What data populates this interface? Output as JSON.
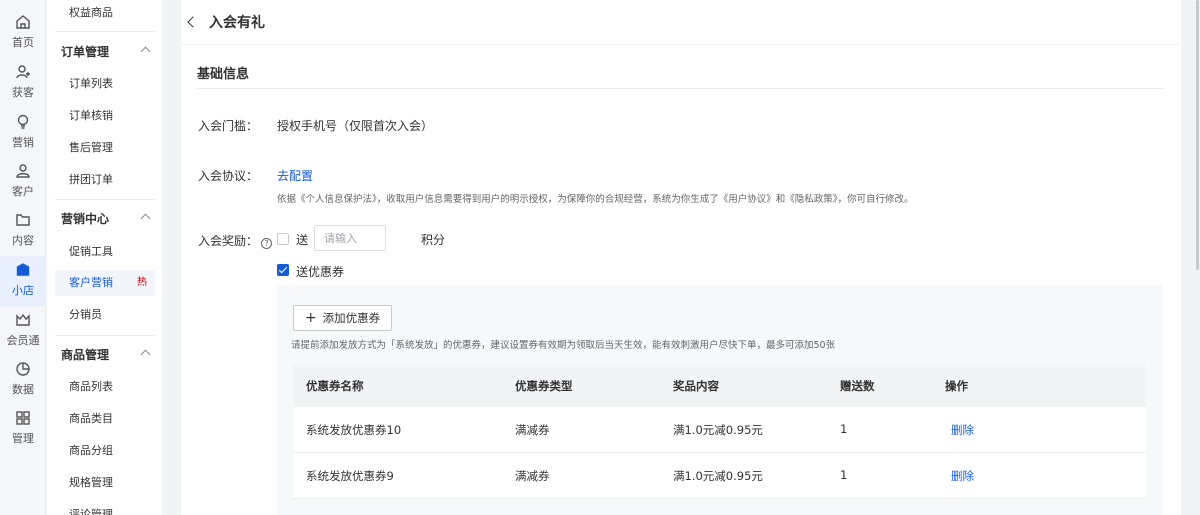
{
  "rail": [
    {
      "label": "首页",
      "icon": "home-icon"
    },
    {
      "label": "获客",
      "icon": "user-add-icon"
    },
    {
      "label": "营销",
      "icon": "bulb-icon"
    },
    {
      "label": "客户",
      "icon": "user-icon"
    },
    {
      "label": "内容",
      "icon": "folder-icon"
    },
    {
      "label": "小店",
      "icon": "store-icon",
      "active": true
    },
    {
      "label": "会员通",
      "icon": "crown-icon"
    },
    {
      "label": "数据",
      "icon": "pie-chart-icon"
    },
    {
      "label": "管理",
      "icon": "grid-icon"
    }
  ],
  "submenu": {
    "top_item": "权益商品",
    "groups": [
      {
        "title": "订单管理",
        "items": [
          "订单列表",
          "订单核销",
          "售后管理",
          "拼团订单"
        ]
      },
      {
        "title": "营销中心",
        "items": [
          "促销工具",
          "客户营销",
          "分销员"
        ]
      },
      {
        "title": "商品管理",
        "items": [
          "商品列表",
          "商品类目",
          "商品分组",
          "规格管理",
          "评论管理"
        ]
      }
    ],
    "active_item": "客户营销",
    "hot_badge": "热"
  },
  "header": {
    "title": "入会有礼"
  },
  "section": {
    "title": "基础信息"
  },
  "form": {
    "threshold": {
      "label": "入会门槛：",
      "value": "授权手机号（仅限首次入会）"
    },
    "agreement": {
      "label": "入会协议：",
      "link": "去配置",
      "help": "依据《个人信息保护法》，收取用户信息需要得到用户的明示授权，为保障你的合规经营，系统为你生成了《用户协议》和《隐私政策》，你可自行修改。"
    },
    "reward": {
      "label": "入会奖励：",
      "help_icon": "?",
      "points_checkbox_label": "送",
      "points_checked": false,
      "points_placeholder": "请输入",
      "points_unit": "积分",
      "coupon_checkbox_label": "送优惠券",
      "coupon_checked": true
    }
  },
  "coupon_panel": {
    "add_button": "添加优惠券",
    "add_icon": "+",
    "tip": "请提前添加发放方式为「系统发放」的优惠券，建议设置券有效期为领取后当天生效，能有效刺激用户尽快下单，最多可添加50张",
    "columns": [
      "优惠券名称",
      "优惠券类型",
      "奖品内容",
      "赠送数",
      "操作"
    ],
    "rows": [
      {
        "name": "系统发放优惠券10",
        "type": "满减券",
        "content": "满1.0元减0.95元",
        "count": "1",
        "action": "删除"
      },
      {
        "name": "系统发放优惠券9",
        "type": "满减券",
        "content": "满1.0元减0.95元",
        "count": "1",
        "action": "删除"
      }
    ]
  },
  "colors": {
    "accent": "#155bd4",
    "hot": "#d40000",
    "background": "#f2f3f5"
  }
}
